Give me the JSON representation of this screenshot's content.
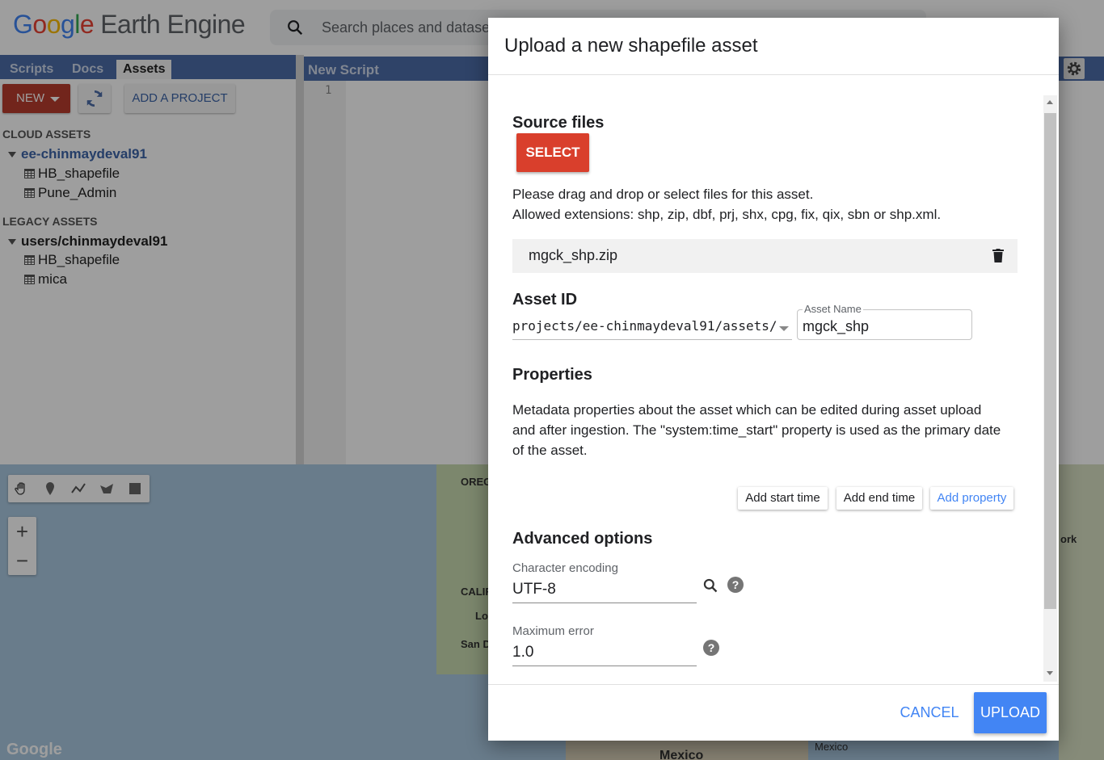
{
  "app": {
    "logo_google": [
      "G",
      "o",
      "o",
      "g",
      "l",
      "e"
    ],
    "logo_product": "Earth Engine",
    "search_placeholder": "Search places and datasets"
  },
  "left_panel": {
    "tabs": [
      {
        "label": "Scripts",
        "active": false
      },
      {
        "label": "Docs",
        "active": false
      },
      {
        "label": "Assets",
        "active": true
      }
    ],
    "new_label": "NEW",
    "add_project_label": "ADD A PROJECT",
    "cloud_assets_heading": "CLOUD ASSETS",
    "cloud_root": "ee-chinmaydeval91",
    "cloud_items": [
      "HB_shapefile",
      "Pune_Admin"
    ],
    "legacy_assets_heading": "LEGACY ASSETS",
    "legacy_root": "users/chinmaydeval91",
    "legacy_items": [
      "HB_shapefile",
      "mica"
    ]
  },
  "editor": {
    "title": "New Script",
    "line_number": "1"
  },
  "map": {
    "labels": [
      "OREG",
      "CALIF",
      "Lo",
      "San D",
      "ork",
      "Mexico",
      "Mexico"
    ],
    "attribution": "Google"
  },
  "dialog": {
    "title": "Upload a new shapefile asset",
    "source_files_heading": "Source files",
    "select_label": "SELECT",
    "drag_text": "Please drag and drop or select files for this asset.",
    "extensions_text": "Allowed extensions: shp, zip, dbf, prj, shx, cpg, fix, qix, sbn or shp.xml.",
    "file_name": "mgck_shp.zip",
    "asset_id_heading": "Asset ID",
    "asset_prefix": "projects/ee-chinmaydeval91/assets/",
    "asset_name_label": "Asset Name",
    "asset_name_value": "mgck_shp",
    "properties_heading": "Properties",
    "properties_text_1": "Metadata properties about the asset which can be edited during asset upload",
    "properties_text_2": "and after ingestion. The \"system:time_start\" property is used as the primary date",
    "properties_text_3": "of the asset.",
    "add_start_time": "Add start time",
    "add_end_time": "Add end time",
    "add_property": "Add property",
    "advanced_heading": "Advanced options",
    "encoding_label": "Character encoding",
    "encoding_value": "UTF-8",
    "max_error_label": "Maximum error",
    "max_error_value": "1.0",
    "help_glyph": "?",
    "cancel_label": "CANCEL",
    "upload_label": "UPLOAD"
  },
  "colors": {
    "accent_blue": "#4285f4",
    "danger_red": "#d93f2c",
    "tab_bar": "#4c6ca8"
  }
}
